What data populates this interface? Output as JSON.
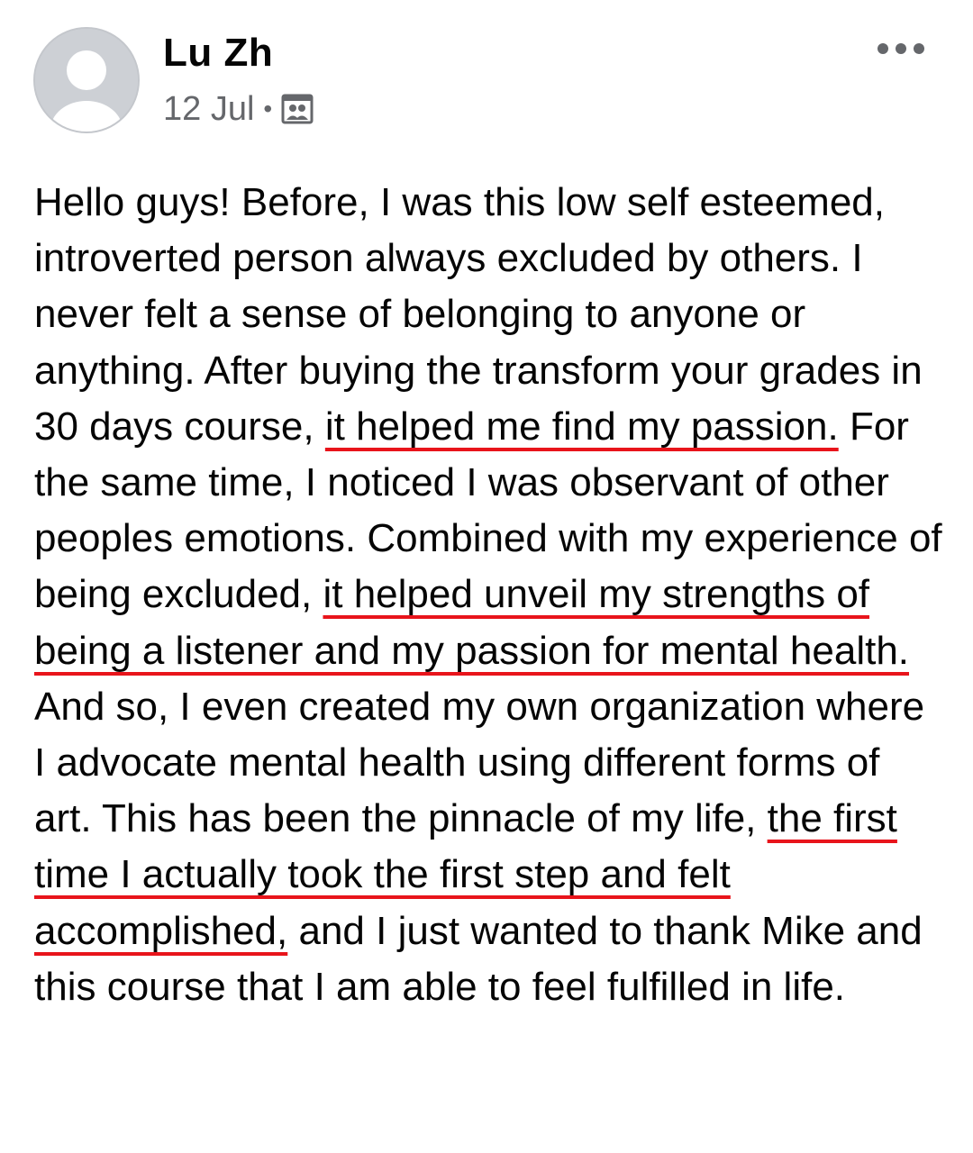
{
  "post": {
    "author_name": "Lu Zh",
    "date": "12 Jul",
    "separator": "•",
    "audience_icon": "group-audience-icon",
    "avatar_icon": "default-avatar-icon",
    "more_icon": "more-options-icon",
    "body": [
      {
        "text": "Hello guys! Before, I was this low self esteemed, introverted person always excluded by others. I never felt a sense of belonging to anyone or anything. After buying the transform your grades in 30 days course, ",
        "highlight": false
      },
      {
        "text": "it helped me find my passion.",
        "highlight": true
      },
      {
        "text": " For the same time, I noticed I was observant of other peoples emotions. Combined with my experience of being excluded, ",
        "highlight": false
      },
      {
        "text": "it helped unveil my strengths of being a listener and my passion for mental health.",
        "highlight": true
      },
      {
        "text": " And so, I even created my own organization where I advocate mental health using different forms of art. This has been the pinnacle of my life, ",
        "highlight": false
      },
      {
        "text": "the first time I actually took the first step and felt accomplished,",
        "highlight": true
      },
      {
        "text": " and I just wanted to thank Mike and this course that I am able to feel fulfilled in life.",
        "highlight": false
      }
    ]
  },
  "colors": {
    "text": "#050505",
    "meta": "#65676b",
    "highlight_underline": "#e8141b",
    "avatar_bg": "#cdd0d5"
  }
}
